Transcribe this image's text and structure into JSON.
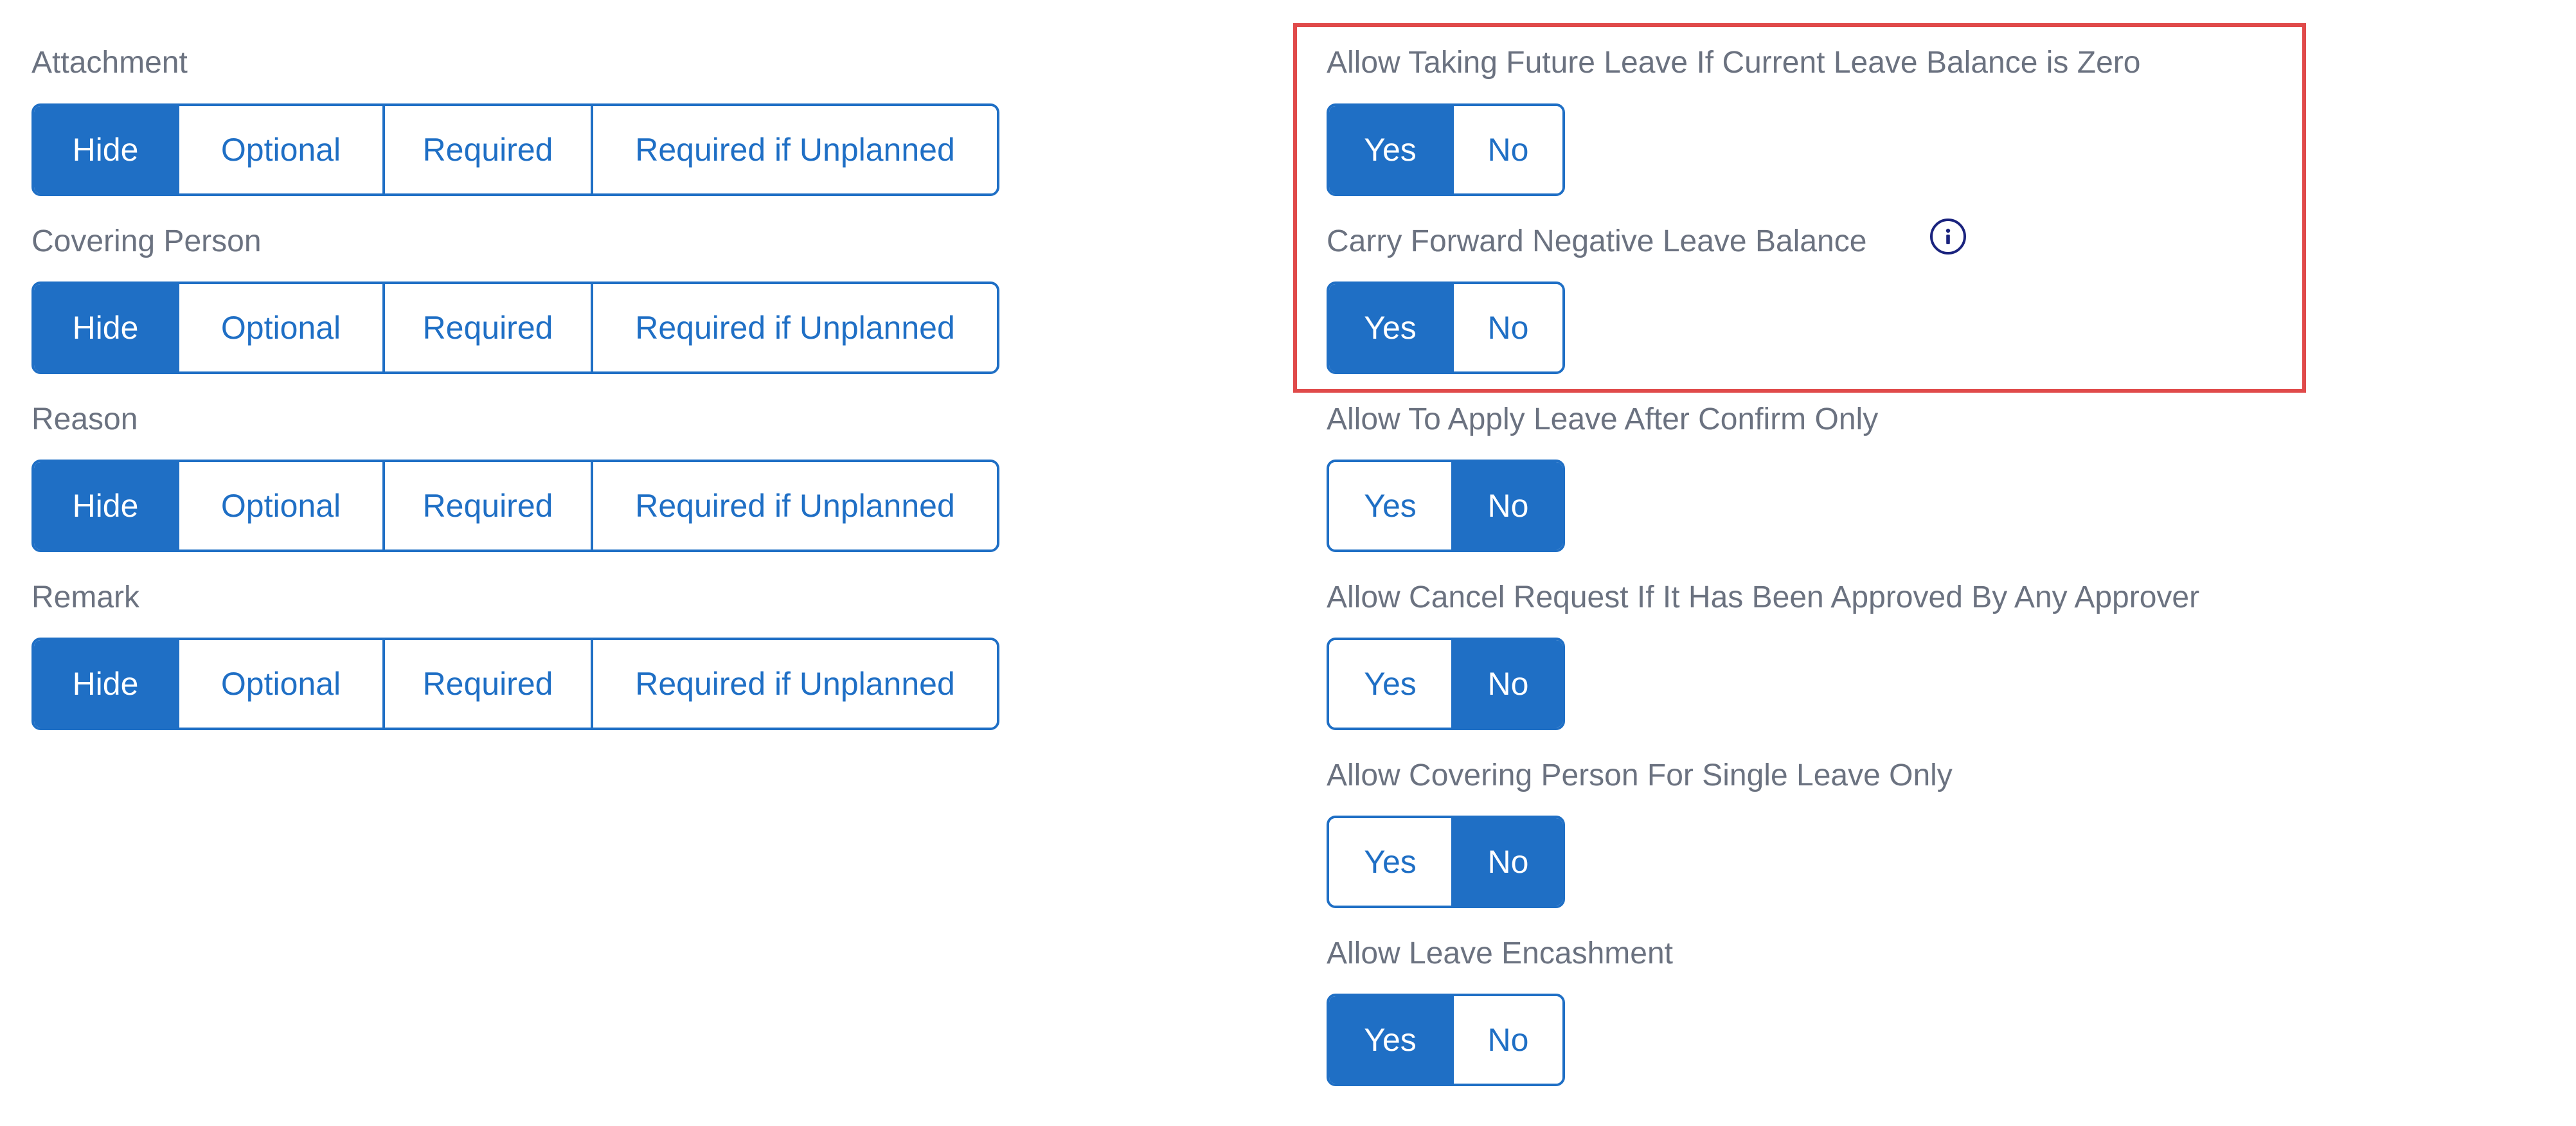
{
  "left_fields": [
    {
      "label": "Attachment",
      "options": [
        "Hide",
        "Optional",
        "Required",
        "Required if Unplanned"
      ],
      "selected": "Hide"
    },
    {
      "label": "Covering Person",
      "options": [
        "Hide",
        "Optional",
        "Required",
        "Required if Unplanned"
      ],
      "selected": "Hide"
    },
    {
      "label": "Reason",
      "options": [
        "Hide",
        "Optional",
        "Required",
        "Required if Unplanned"
      ],
      "selected": "Hide"
    },
    {
      "label": "Remark",
      "options": [
        "Hide",
        "Optional",
        "Required",
        "Required if Unplanned"
      ],
      "selected": "Hide"
    }
  ],
  "right_fields": [
    {
      "label": "Allow Taking Future Leave If Current Leave Balance is Zero",
      "options": [
        "Yes",
        "No"
      ],
      "selected": "Yes"
    },
    {
      "label": "Carry Forward Negative Leave Balance",
      "options": [
        "Yes",
        "No"
      ],
      "selected": "Yes",
      "info_icon": "info-circle-icon"
    },
    {
      "label": "Allow To Apply Leave After Confirm Only",
      "options": [
        "Yes",
        "No"
      ],
      "selected": "No"
    },
    {
      "label": "Allow Cancel Request If It Has Been Approved By Any Approver",
      "options": [
        "Yes",
        "No"
      ],
      "selected": "No"
    },
    {
      "label": "Allow Covering Person For Single Leave Only",
      "options": [
        "Yes",
        "No"
      ],
      "selected": "No"
    },
    {
      "label": "Allow Leave Encashment",
      "options": [
        "Yes",
        "No"
      ],
      "selected": "Yes"
    }
  ],
  "colors": {
    "accent": "#1f6fc5",
    "label": "#6b7280",
    "highlight": "#e04a4a",
    "info_icon": "#1a237e"
  }
}
